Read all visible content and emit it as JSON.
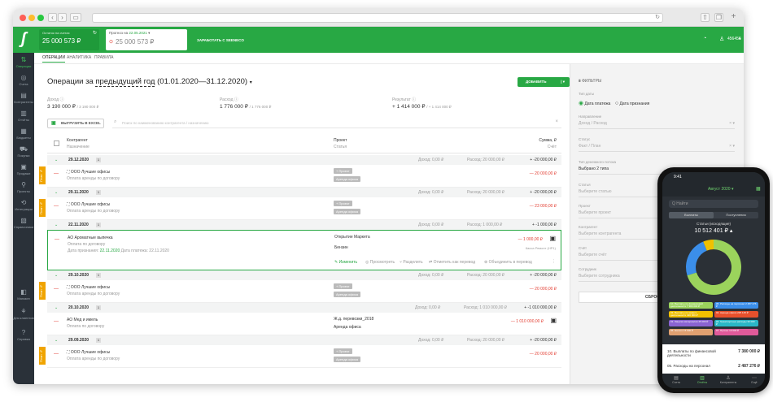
{
  "topbar": {
    "balance_label": "Остаток на счетах",
    "balance": "25 000 573 ₽",
    "forecast_label": "Прогноз на",
    "forecast_date": "22.05.2021",
    "forecast_sep": " ▾",
    "forecast_value": "25 000 573 ₽",
    "earn": "ЗАРАБОТАТЬ С SEENECO",
    "user": "456456"
  },
  "tabs": [
    "ОПЕРАЦИИ",
    "АНАЛИТИКА",
    "ПРАВИЛА"
  ],
  "sidebar": [
    "Операции",
    "Счета",
    "Контрагенты",
    "Отчёты",
    "Бюджеты",
    "Покупки",
    "Продажи",
    "Проекты",
    "Интеграции",
    "Справочники",
    "Магазин",
    "Для клиентов",
    "Справка"
  ],
  "header": {
    "title_prefix": "Операции за",
    "title_period": "предыдущий год",
    "title_range": "(01.01.2020—31.12.2020)",
    "add": "ДОБАВИТЬ",
    "income_label": "Доход",
    "income": "3 190 000 ₽",
    "income_sub": "/ 3 190 000 ₽",
    "expense_label": "Расход",
    "expense": "1 776 000 ₽",
    "expense_sub": "/ 1 776 000 ₽",
    "result_label": "Результат",
    "result": "+ 1 414 000 ₽",
    "result_sub": "/ + 1 414 000 ₽",
    "excel": "ВЫГРУЗИТЬ В EXCEL",
    "search_ph": "Поиск по наименованию контрагента / назначению"
  },
  "cols": {
    "c1": "Контрагент",
    "c1s": "Назначение",
    "c2": "Проект",
    "c2s": "Статья",
    "c3": "Сумма, ₽",
    "c3s": "Счёт"
  },
  "groups": [
    {
      "date": "29.12.2020",
      "n": "1",
      "inc": "Доход: 0,00 ₽",
      "exp": "Расход: 20 000,00 ₽",
      "tot": "+ -20 000,00 ₽"
    },
    {
      "date": "29.11.2020",
      "n": "1",
      "inc": "Доход: 0,00 ₽",
      "exp": "Расход: 20 000,00 ₽",
      "tot": "+ -20 000,00 ₽"
    },
    {
      "date": "22.11.2020",
      "n": "1",
      "inc": "Доход: 0,00 ₽",
      "exp": "Расход: 1 000,00 ₽",
      "tot": "+ -1 000,00 ₽"
    },
    {
      "date": "29.10.2020",
      "n": "1",
      "inc": "Доход: 0,00 ₽",
      "exp": "Расход: 20 000,00 ₽",
      "tot": "+ -20 000,00 ₽"
    },
    {
      "date": "20.10.2020",
      "n": "1",
      "inc": "Доход: 0,00 ₽",
      "exp": "Расход: 1 010 000,00 ₽",
      "tot": "+ -1 010 000,00 ₽"
    },
    {
      "date": "29.09.2020",
      "n": "1",
      "inc": "Доход: 0,00 ₽",
      "exp": "Расход: 20 000,00 ₽",
      "tot": "+ -20 000,00 ₽"
    }
  ],
  "ops": [
    {
      "name": "ООО Лучшие офисы",
      "sub": "Оплата аренды по договору",
      "proj": "+ Проект",
      "art": "Аренда офиса",
      "sum": "— 20 000,00 ₽",
      "ribbon": "План ✎"
    },
    {
      "name": "ООО Лучшие офисы",
      "sub": "Оплата аренды по договору",
      "proj": "+ Проект",
      "art": "Аренда офиса",
      "sum": "— 23 000,00 ₽",
      "ribbon": "План ✎"
    },
    {
      "name": "АО Ароматные выпечка",
      "sub": "Оплата по договору",
      "proj": "Открытие Маркета",
      "art": "Бензин",
      "sum": "— 1 000,00 ₽",
      "acct": "Касса Ремонт (НР1)",
      "dates": "Дата признания:",
      "d1": "22.11.2020",
      "dates2": "Дата платежа: 22.11.2020"
    },
    {
      "name": "ООО Лучшие офисы",
      "sub": "Оплата аренды по договору",
      "proj": "+ Проект",
      "art": "Аренда офиса",
      "sum": "— 20 000,00 ₽",
      "ribbon": "План ✎"
    },
    {
      "name": "АО Мед и имель",
      "sub": "Оплата по договору",
      "proj": "Ж.д. перевозки_2018",
      "art": "Аренда офиса",
      "sum": "— 1 010 000,00 ₽"
    },
    {
      "name": "ООО Лучшие офисы",
      "sub": "Оплата аренды по договору",
      "proj": "+ Проект",
      "art": "Аренда офиса",
      "sum": "— 20 000,00 ₽",
      "ribbon": "План ✎"
    }
  ],
  "actions": [
    "✎ Изменить",
    "◎ Просмотреть",
    "⑂ Разделить",
    "⇄ Отметить как перевод",
    "⊕ Объединить в перевод"
  ],
  "filters": {
    "title": "ФИЛЬТРЫ",
    "date_type": "Тип даты",
    "opt1": "Дата платежа",
    "opt2": "Дата признания",
    "dir": "Направление",
    "dir_v": "Доход / Расход",
    "status": "Статус",
    "status_v": "Факт / План",
    "money": "Тип денежного потока",
    "money_v": "Выбрано 2 типа",
    "art": "Статья",
    "art_v": "Выберите статью",
    "proj": "Проект",
    "proj_v": "Выберите проект",
    "ctr": "Контрагент",
    "ctr_v": "Выберите контрагента",
    "acct": "Счёт",
    "acct_v": "Выберите счёт",
    "emp": "Сотрудник",
    "emp_v": "Выберите сотрудника",
    "reset": "СБРОСИТЬ"
  },
  "phone": {
    "time": "9:41",
    "month": "Август 2020 ▾",
    "search": "Q Найти",
    "t1": "Выплаты",
    "t2": "Поступления",
    "sum_label": "Статьи (исходящие)",
    "sum": "10 512 401 ₽ ▴",
    "bottom1": "10. Выплаты по финансовой деятельности",
    "bottom1v": "7 380 000 ₽",
    "bottom2": "05. Расходы на персонал",
    "bottom2v": "2 487 276 ₽",
    "nav": [
      "Счета",
      "Отчёты",
      "Контрагенты",
      "Ещё"
    ],
    "legend": [
      {
        "t": "10. Выплаты по финансовой деятельности 7 380 000 ₽",
        "c": "#9bd35c"
      },
      {
        "t": "05. Расходы на персонал 2 487 276 ₽",
        "c": "#3b8eea"
      },
      {
        "t": "03. Выплаты по инвест. деятельности 420 000 ₽",
        "c": "#f0c000"
      },
      {
        "t": "04. Аренда офиса 225 125 ₽",
        "c": "#e7502c"
      },
      {
        "t": "01. Закупка материалов 45 000 ₽",
        "c": "#8a63d2"
      },
      {
        "t": "02. Транспортные расходы 30 000 ₽",
        "c": "#2ab7c6"
      },
      {
        "t": "06. Налоги 15 000 ₽",
        "c": "#e0a070"
      },
      {
        "t": "07. Прочее 10 000 ₽",
        "c": "#e05a9a"
      }
    ]
  },
  "chart_data": {
    "type": "pie",
    "title": "Статьи (исходящие)",
    "total": "10 512 401 ₽",
    "categories": [
      "10. Выплаты по финансовой деятельности",
      "05. Расходы на персонал",
      "Прочее"
    ],
    "values": [
      7380000,
      2487276,
      645125
    ]
  }
}
